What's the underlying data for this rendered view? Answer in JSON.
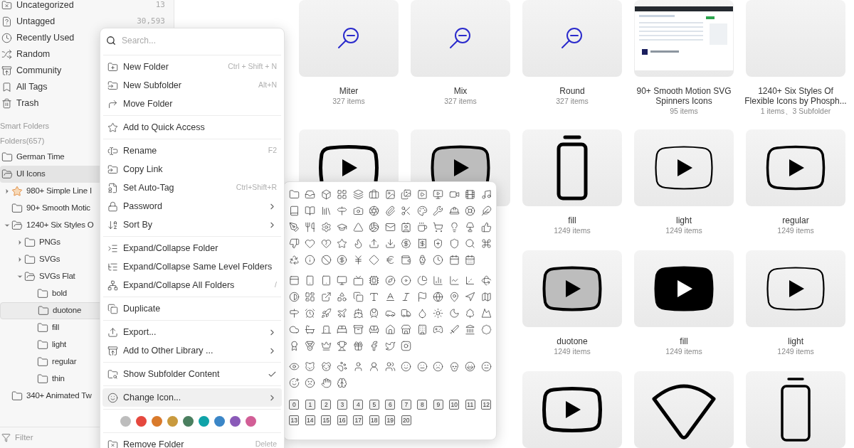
{
  "sidebar": {
    "library_items": [
      {
        "label": "Uncategorized",
        "count": "13"
      },
      {
        "label": "Untagged",
        "count": "30,593"
      },
      {
        "label": "Recently Used"
      },
      {
        "label": "Random"
      },
      {
        "label": "Community"
      },
      {
        "label": "All Tags"
      },
      {
        "label": "Trash"
      }
    ],
    "smart_folders_heading": "Smart Folders",
    "folders_heading": "Folders(657)",
    "folders": [
      {
        "label": "German Time",
        "kind": "folder",
        "selected": false
      },
      {
        "label": "UI Icons",
        "kind": "folder-open",
        "selected": true,
        "children": [
          {
            "label": "980+ Simple Line I",
            "kind": "starred",
            "expanded": false,
            "selected": false
          },
          {
            "label": "90+ Smooth Motic",
            "kind": "folder",
            "selected": false
          },
          {
            "label": "1240+ Six Styles O",
            "kind": "folder-open",
            "expanded": true,
            "selected": false,
            "children": [
              {
                "label": "PNGs",
                "kind": "folder",
                "expanded": false,
                "selected": false
              },
              {
                "label": "SVGs",
                "kind": "folder",
                "expanded": false,
                "selected": false
              },
              {
                "label": "SVGs Flat",
                "kind": "folder-open",
                "expanded": true,
                "selected": false,
                "children": [
                  {
                    "label": "bold",
                    "kind": "folder",
                    "selected": false
                  },
                  {
                    "label": "duotone",
                    "kind": "folder",
                    "selected": true
                  },
                  {
                    "label": "fill",
                    "kind": "folder",
                    "selected": false
                  },
                  {
                    "label": "light",
                    "kind": "folder",
                    "selected": false
                  },
                  {
                    "label": "regular",
                    "kind": "folder",
                    "selected": false
                  },
                  {
                    "label": "thin",
                    "kind": "folder",
                    "selected": false
                  }
                ]
              }
            ]
          },
          {
            "label": "340+ Animated Tw",
            "kind": "folder",
            "selected": false
          }
        ]
      }
    ],
    "filter": {
      "placeholder": "Filter"
    }
  },
  "grid_rows": [
    {
      "tiles": [
        {
          "kind": "magnifier",
          "name": "Miter",
          "count": "327 items"
        },
        {
          "kind": "magnifier",
          "name": "Mix",
          "count": "327 items"
        },
        {
          "kind": "magnifier",
          "name": "Round",
          "count": "327 items"
        },
        {
          "kind": "screenshot",
          "name": "90+ Smooth Motion SVG Spinners Icons",
          "count": "95 items"
        },
        {
          "kind": "blank",
          "name": "1240+ Six Styles Of Flexible Icons by Phosph...",
          "count": "1 items、3 Subfolder"
        }
      ]
    },
    {
      "tiles": [
        {
          "kind": "video-bold"
        },
        {
          "kind": "video-duotone"
        },
        {
          "kind": "battery-bold",
          "name": "fill",
          "count": "1249 items"
        },
        {
          "kind": "video-light",
          "name": "light",
          "count": "1249 items"
        },
        {
          "kind": "video-regular",
          "name": "regular",
          "count": "1249 items"
        }
      ]
    },
    {
      "tiles": [
        {
          "kind": "video-duotone",
          "name": "duotone",
          "count": "1249 items"
        },
        {
          "kind": "video-fill",
          "name": "fill",
          "count": "1249 items"
        },
        {
          "kind": "video-light",
          "name": "light",
          "count": "1249 items"
        }
      ]
    },
    {
      "tiles": [
        {
          "kind": "video-bold"
        },
        {
          "kind": "wifi-bold"
        },
        {
          "kind": "battery-regular"
        }
      ]
    }
  ],
  "context_menu": {
    "search": {
      "placeholder": "Search..."
    },
    "groups": [
      {
        "kind": "items",
        "items": [
          {
            "label": "New Folder",
            "shortcut": "Ctrl + Shift + N",
            "submenu": false,
            "checked": false,
            "selected": false
          },
          {
            "label": "New Subfolder",
            "shortcut": "Alt+N",
            "submenu": false,
            "checked": false,
            "selected": false
          },
          {
            "label": "Move Folder",
            "submenu": false,
            "checked": false,
            "selected": false
          }
        ]
      },
      {
        "kind": "items",
        "items": [
          {
            "label": "Add to Quick Access",
            "submenu": false,
            "checked": false,
            "selected": false
          }
        ]
      },
      {
        "kind": "items",
        "items": [
          {
            "label": "Rename",
            "shortcut": "F2",
            "submenu": false,
            "checked": false,
            "selected": false
          },
          {
            "label": "Copy Link",
            "submenu": false,
            "checked": false,
            "selected": false
          },
          {
            "label": "Set Auto-Tag",
            "shortcut": "Ctrl+Shift+R",
            "submenu": false,
            "checked": false,
            "selected": false
          },
          {
            "label": "Password",
            "submenu": true,
            "checked": false,
            "selected": false
          },
          {
            "label": "Sort By",
            "submenu": true,
            "checked": false,
            "selected": false
          }
        ]
      },
      {
        "kind": "items",
        "items": [
          {
            "label": "Expand/Collapse Folder",
            "submenu": false,
            "checked": false,
            "selected": false
          },
          {
            "label": "Expand/Collapse Same Level Folders",
            "submenu": false,
            "checked": false,
            "selected": false
          },
          {
            "label": "Expand/Collapse All Folders",
            "shortcut": "/",
            "submenu": false,
            "checked": false,
            "selected": false
          }
        ]
      },
      {
        "kind": "items",
        "items": [
          {
            "label": "Duplicate",
            "submenu": false,
            "checked": false,
            "selected": false
          }
        ]
      },
      {
        "kind": "items",
        "items": [
          {
            "label": "Export...",
            "submenu": true,
            "checked": false,
            "selected": false
          },
          {
            "label": "Add to Other Library ...",
            "submenu": true,
            "checked": false,
            "selected": false
          }
        ]
      },
      {
        "kind": "items",
        "items": [
          {
            "label": "Show Subfolder Content",
            "submenu": false,
            "checked": true,
            "selected": false
          }
        ]
      },
      {
        "kind": "items",
        "items": [
          {
            "label": "Change Icon...",
            "submenu": true,
            "checked": false,
            "selected": true
          }
        ]
      },
      {
        "kind": "colors",
        "colors": [
          {
            "color": "#bdbdbd"
          },
          {
            "color": "#e5483e"
          },
          {
            "color": "#d97a2b"
          },
          {
            "color": "#c99a3e"
          },
          {
            "color": "#4a7f5f"
          },
          {
            "color": "#0fa3a8"
          },
          {
            "color": "#3b86c7"
          },
          {
            "color": "#8a5ab8"
          },
          {
            "color": "#d25e96"
          }
        ]
      },
      {
        "kind": "items",
        "items": [
          {
            "label": "Remove Folder",
            "shortcut": "Delete",
            "submenu": false,
            "checked": false,
            "selected": false
          }
        ]
      }
    ]
  },
  "icon_picker": {
    "number_badges": [
      "0",
      "1",
      "2",
      "3",
      "4",
      "5",
      "6",
      "7",
      "8",
      "9",
      "10",
      "11",
      "12",
      "13",
      "14",
      "15",
      "16",
      "17",
      "18",
      "19",
      "20"
    ]
  }
}
